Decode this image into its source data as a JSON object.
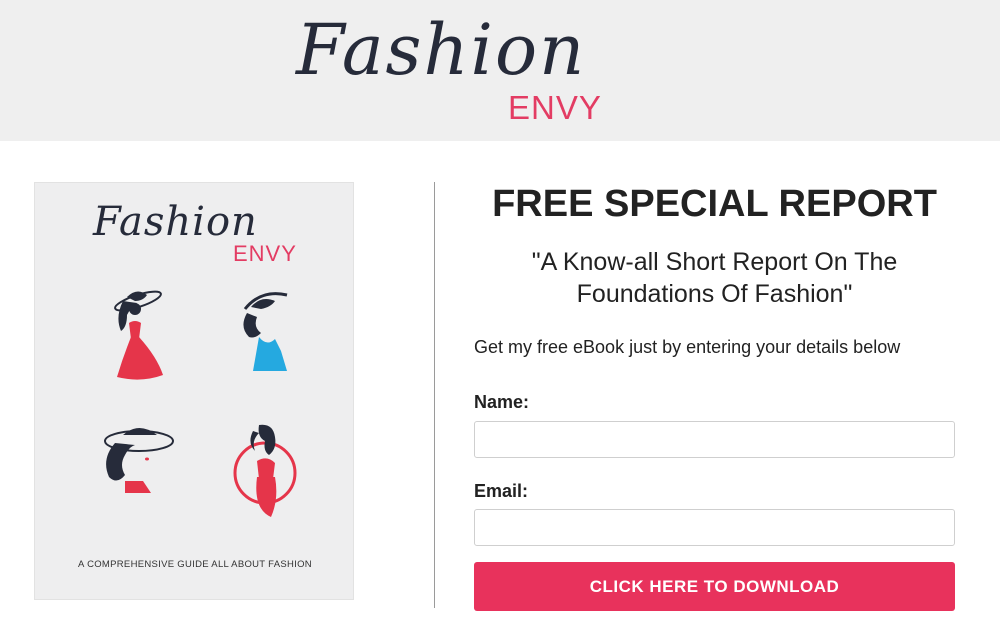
{
  "header": {
    "logo_script": "Fashion",
    "logo_sub": "ENVY"
  },
  "cover": {
    "logo_script": "Fashion",
    "logo_sub": "ENVY",
    "caption": "A COMPREHENSIVE GUIDE ALL ABOUT FASHION"
  },
  "main": {
    "headline": "FREE SPECIAL REPORT",
    "subhead": "\"A Know-all Short Report On The Foundations Of Fashion\"",
    "intro": "Get my free eBook just by entering your details below"
  },
  "form": {
    "name_label": "Name:",
    "name_value": "",
    "email_label": "Email:",
    "email_value": "",
    "submit_label": "CLICK HERE TO DOWNLOAD"
  },
  "colors": {
    "brand_dark": "#262b3a",
    "brand_pink": "#e33c63",
    "button": "#e8325c",
    "header_bg": "#efefef",
    "cover_blue": "#25a9e0",
    "cover_red": "#e5354a"
  }
}
